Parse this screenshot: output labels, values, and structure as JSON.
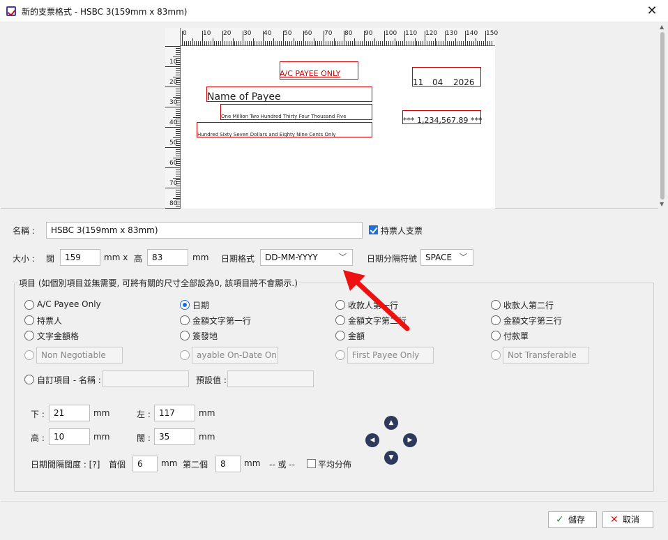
{
  "window": {
    "title": "新的支票格式 - HSBC 3(159mm x 83mm)",
    "close_glyph": "✕"
  },
  "icons": {
    "app": "checkbook-app-icon",
    "close": "close-icon",
    "arrow_up": "arrow-up-icon",
    "arrow_down": "arrow-down-icon",
    "arrow_left": "arrow-left-icon",
    "arrow_right": "arrow-right-icon",
    "save": "checkmark-icon",
    "cancel": "x-icon"
  },
  "colors": {
    "accent": "#1e6fd9",
    "box_red": "#cc0000",
    "nav_button": "#2d3a5c"
  },
  "preview": {
    "ruler_top_labels": [
      "0",
      "10",
      "20",
      "30",
      "40",
      "50",
      "60",
      "70",
      "80",
      "90",
      "100",
      "110",
      "120",
      "130",
      "140",
      "150"
    ],
    "ruler_left_labels": [
      "10",
      "20",
      "30",
      "40",
      "50",
      "60",
      "70",
      "80"
    ],
    "ac_payee": "A/C PAYEE ONLY",
    "date_day": "11",
    "date_month": "04",
    "date_year": "2026",
    "payee_name": "Name of Payee",
    "amount_words_1": "One Million Two Hundred Thirty Four Thousand Five",
    "amount_words_2": "Hundred Sixty Seven Dollars and Eighty Nine Cents Only",
    "amount_figure": "*** 1,234,567.89 ***"
  },
  "form": {
    "name_label": "名稱 :",
    "name_value": "HSBC 3(159mm x 83mm)",
    "bearer_label": "持票人支票",
    "bearer_checked": true,
    "size_label": "大小 :",
    "width_label": "闊",
    "width_value": "159",
    "mm_x": "mm  x",
    "height_label": "高",
    "height_value": "83",
    "mm": "mm",
    "date_format_label": "日期格式",
    "date_format_value": "DD-MM-YYYY",
    "date_sep_label": "日期分隔符號",
    "date_sep_value": "SPACE"
  },
  "items": {
    "group_title": "項目 (如個別項目並無需要, 可將有關的尺寸全部設為0, 該項目將不會顯示.)",
    "radios": [
      {
        "label": "A/C Payee Only",
        "checked": false
      },
      {
        "label": "日期",
        "checked": true
      },
      {
        "label": "收款人第一行",
        "checked": false
      },
      {
        "label": "收款人第二行",
        "checked": false
      },
      {
        "label": "持票人",
        "checked": false
      },
      {
        "label": "金額文字第一行",
        "checked": false
      },
      {
        "label": "金額文字第二行",
        "checked": false
      },
      {
        "label": "金額文字第三行",
        "checked": false
      },
      {
        "label": "文字金額格",
        "checked": false
      },
      {
        "label": "簽發地",
        "checked": false
      },
      {
        "label": "金額",
        "checked": false
      },
      {
        "label": "付款單",
        "checked": false
      }
    ],
    "disabled_options": [
      {
        "placeholder": "Non Negotiable"
      },
      {
        "placeholder": "ayable On-Date Only"
      },
      {
        "placeholder": "First Payee Only"
      },
      {
        "placeholder": "Not Transferable"
      }
    ],
    "custom_label": "自訂項目  - 名稱 :",
    "default_label": "預設值 :",
    "bottom_label": "下 :",
    "bottom_value": "21",
    "left_label": "左 :",
    "left_value": "117",
    "h_label": "高 :",
    "h_value": "10",
    "w_label": "闊 :",
    "w_value": "35",
    "spacing_label": "日期間隔闊度 : [?]",
    "first_label": "首個",
    "first_value": "6",
    "second_label": "第二個",
    "second_value": "8",
    "or_label": "-- 或 --",
    "even_label": "平均分佈",
    "even_checked": false
  },
  "buttons": {
    "save": "儲存",
    "cancel": "取消"
  }
}
